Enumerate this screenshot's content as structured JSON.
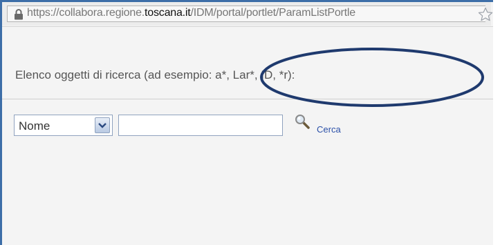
{
  "browser": {
    "url_prefix": "https://collabora.regione.",
    "url_domain": "toscana.it",
    "url_suffix": "/IDM/portal/portlet/ParamListPortle"
  },
  "portlet": {
    "prompt": "Elenco oggetti di ricerca (ad esempio: a*, Lar*, ID, *r):",
    "search": {
      "field_select_value": "Nome",
      "input_value": "",
      "search_link_label": "Cerca"
    }
  },
  "annotation": {
    "color": "#1f3a6e"
  }
}
